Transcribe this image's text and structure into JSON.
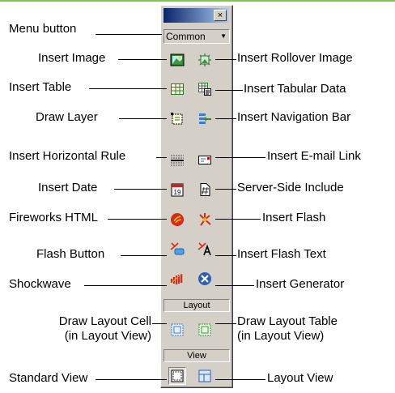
{
  "palette": {
    "close_glyph": "×",
    "category": "Common",
    "dropdown_arrow": "▼",
    "section_layout": "Layout",
    "section_view": "View",
    "titlebar_colors": [
      "#0a246a",
      "#a6caf0"
    ]
  },
  "labels": {
    "menu_button": "Menu button",
    "insert_image": "Insert Image",
    "insert_rollover_image": "Insert Rollover Image",
    "insert_table": "Insert Table",
    "insert_tabular_data": "Insert Tabular Data",
    "draw_layer": "Draw Layer",
    "insert_navigation_bar": "Insert Navigation Bar",
    "insert_horizontal_rule": "Insert Horizontal Rule",
    "insert_email_link": "Insert E-mail Link",
    "insert_date": "Insert Date",
    "server_side_include": "Server-Side Include",
    "fireworks_html": "Fireworks HTML",
    "insert_flash": "Insert Flash",
    "flash_button": "Flash Button",
    "insert_flash_text": "Insert Flash Text",
    "shockwave": "Shockwave",
    "insert_generator": "Insert Generator",
    "draw_layout_cell": "Draw Layout Cell",
    "draw_layout_cell_sub": "(in Layout View)",
    "draw_layout_table": "Draw Layout Table",
    "draw_layout_table_sub": "(in Layout View)",
    "standard_view": "Standard View",
    "layout_view": "Layout View"
  },
  "icons": {
    "image": "image-icon",
    "rollover": "rollover-image-icon",
    "table": "table-icon",
    "tabular_data": "tabular-data-icon",
    "layer": "layer-icon",
    "navbar": "navigation-bar-icon",
    "hr": "horizontal-rule-icon",
    "email": "email-link-icon",
    "date": "date-icon",
    "ssi": "server-side-include-icon",
    "fireworks": "fireworks-html-icon",
    "flash": "flash-icon",
    "flash_button": "flash-button-icon",
    "flash_text": "flash-text-icon",
    "shockwave": "shockwave-icon",
    "generator": "generator-icon",
    "layout_cell": "layout-cell-icon",
    "layout_table": "layout-table-icon",
    "standard_view": "standard-view-icon",
    "layout_view": "layout-view-icon"
  },
  "icon_date_number": "19"
}
